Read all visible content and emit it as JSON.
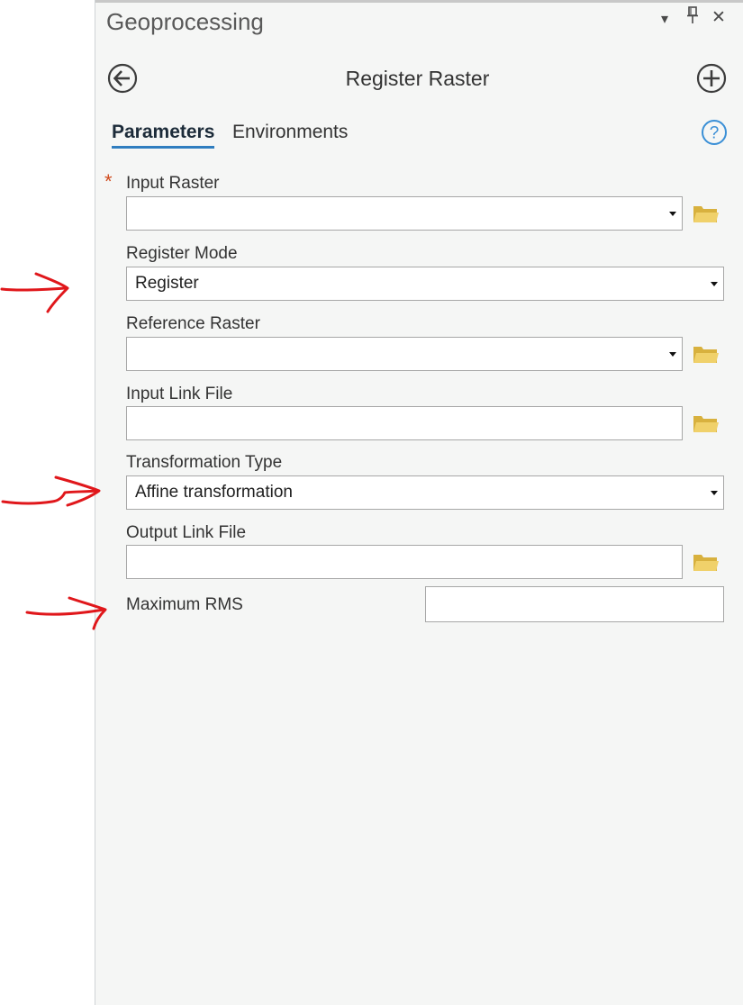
{
  "pane": {
    "title": "Geoprocessing",
    "controls": {
      "menu": "▾",
      "pin": "⊥",
      "close": "✕"
    }
  },
  "tool": {
    "title": "Register Raster",
    "back_icon": "back-arrow-icon",
    "add_icon": "plus-circle-icon",
    "help_icon": "help-icon"
  },
  "tabs": [
    {
      "label": "Parameters",
      "active": true
    },
    {
      "label": "Environments",
      "active": false
    }
  ],
  "params": {
    "input_raster": {
      "label": "Input Raster",
      "value": "",
      "required": true,
      "required_mark": "*"
    },
    "register_mode": {
      "label": "Register Mode",
      "value": "Register"
    },
    "reference_raster": {
      "label": "Reference Raster",
      "value": ""
    },
    "input_link_file": {
      "label": "Input Link File",
      "value": ""
    },
    "transformation_type": {
      "label": "Transformation Type",
      "value": "Affine transformation"
    },
    "output_link_file": {
      "label": "Output Link File",
      "value": ""
    },
    "maximum_rms": {
      "label": "Maximum RMS",
      "value": ""
    }
  },
  "colors": {
    "pane_bg": "#f5f6f5",
    "accent_underline": "#2f7dbf",
    "required_star": "#d04a1c",
    "folder_icon": "#e6c35a",
    "annotation_arrows": "#e0171b",
    "help_icon": "#3a8fd6"
  }
}
